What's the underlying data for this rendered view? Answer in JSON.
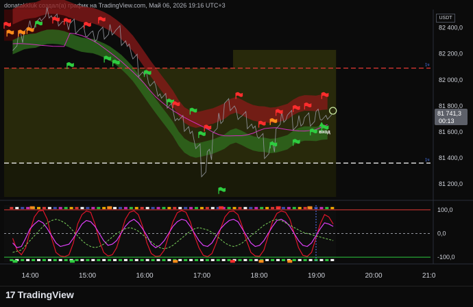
{
  "header": {
    "caption": "donatakkluk создал(а) график на TradingView.com, Май 06, 2026 19:16 UTC+3",
    "currency": "USDT"
  },
  "branding": {
    "logo_text": "TradingView",
    "logo_icon": "tradingview-logo-icon"
  },
  "colors": {
    "background": "#0b0b0b",
    "price_line": "#9598a1",
    "upper_band": "#8b1a1a",
    "lower_band": "#2e6b1e",
    "olive_zone": "#2a2b0c",
    "magenta": "#d02fbf",
    "red_level": "#e53935",
    "white_level": "#ffffff",
    "osc_red": "#e0152a",
    "osc_magenta": "#e040fb",
    "osc_green_dash": "#7cd35b",
    "buy_flag": "#2ecc40",
    "sell_flag": "#ff2d2d",
    "orange_flag": "#ff8c1a",
    "price_label_bg": "#5d6069"
  },
  "price_label": {
    "value": "81 741,3",
    "countdown": "00:13"
  },
  "annotation": {
    "text": "вход"
  },
  "level_tags": [
    "1ч",
    "1ч"
  ],
  "chart_data": [
    {
      "type": "line",
      "title": "",
      "xlabel": "",
      "ylabel": "",
      "x": [
        "14:00",
        "15:00",
        "16:00",
        "17:00",
        "18:00",
        "19:00",
        "20:00",
        "21:0"
      ],
      "y_ticks": [
        "82 400,0",
        "82 200,0",
        "82 000,0",
        "81 800,0",
        "81 600,0",
        "81 400,0",
        "81 200,0"
      ],
      "ylim": [
        81100,
        82540
      ],
      "grid": false,
      "series": [
        {
          "values": [
            [
              13.7,
              82270
            ],
            [
              13.8,
              82330
            ],
            [
              13.9,
              82390
            ],
            [
              14.0,
              82410
            ],
            [
              14.1,
              82430
            ],
            [
              14.2,
              82480
            ],
            [
              14.3,
              82520
            ],
            [
              14.4,
              82470
            ],
            [
              14.5,
              82450
            ],
            [
              14.6,
              82420
            ],
            [
              14.7,
              82440
            ],
            [
              14.8,
              82400
            ],
            [
              14.9,
              82380
            ],
            [
              15.0,
              82350
            ],
            [
              15.1,
              82330
            ],
            [
              15.2,
              82360
            ],
            [
              15.3,
              82340
            ],
            [
              15.4,
              82390
            ],
            [
              15.5,
              82380
            ],
            [
              15.6,
              82300
            ],
            [
              15.7,
              82230
            ],
            [
              15.8,
              82170
            ],
            [
              15.9,
              82070
            ],
            [
              16.0,
              82020
            ],
            [
              16.1,
              81970
            ],
            [
              16.2,
              81910
            ],
            [
              16.3,
              81850
            ],
            [
              16.4,
              81810
            ],
            [
              16.5,
              81730
            ],
            [
              16.6,
              81690
            ],
            [
              16.7,
              81640
            ],
            [
              16.8,
              81560
            ],
            [
              16.9,
              81480
            ],
            [
              17.0,
              81300
            ],
            [
              17.1,
              81430
            ],
            [
              17.2,
              81610
            ],
            [
              17.3,
              81700
            ],
            [
              17.4,
              81810
            ],
            [
              17.5,
              81790
            ],
            [
              17.6,
              81740
            ],
            [
              17.7,
              81720
            ],
            [
              17.8,
              81660
            ],
            [
              17.9,
              81600
            ],
            [
              18.0,
              81560
            ],
            [
              18.1,
              81440
            ],
            [
              18.2,
              81490
            ],
            [
              18.3,
              81640
            ],
            [
              18.4,
              81710
            ],
            [
              18.5,
              81720
            ],
            [
              18.6,
              81640
            ],
            [
              18.7,
              81690
            ],
            [
              18.8,
              81710
            ],
            [
              18.9,
              81680
            ],
            [
              19.0,
              81730
            ],
            [
              19.1,
              81700
            ],
            [
              19.2,
              81741.3
            ]
          ]
        }
      ],
      "levels": [
        {
          "value": 82090,
          "style": "dashed",
          "color": "#e53935",
          "tag": "1ч"
        },
        {
          "value": 81360,
          "style": "dashed",
          "color": "#ffffff",
          "tag": "1ч"
        }
      ],
      "current_price": 81741.3,
      "buy_flags": [
        [
          14.1,
          82450
        ],
        [
          14.65,
          82130
        ],
        [
          15.3,
          82180
        ],
        [
          15.45,
          82150
        ],
        [
          16.0,
          82070
        ],
        [
          16.4,
          81850
        ],
        [
          16.8,
          81780
        ],
        [
          16.95,
          81600
        ],
        [
          17.3,
          81170
        ],
        [
          18.2,
          81520
        ],
        [
          18.6,
          81540
        ],
        [
          18.9,
          81620
        ],
        [
          19.1,
          81650
        ]
      ],
      "sell_flags": [
        [
          13.55,
          82440
        ],
        [
          14.4,
          82480
        ],
        [
          14.6,
          82470
        ],
        [
          14.95,
          82440
        ],
        [
          15.2,
          82480
        ],
        [
          16.5,
          81830
        ],
        [
          17.05,
          81650
        ],
        [
          17.6,
          81900
        ],
        [
          18.0,
          81680
        ],
        [
          18.3,
          81770
        ],
        [
          18.6,
          81800
        ],
        [
          18.8,
          81820
        ],
        [
          19.1,
          81900
        ]
      ],
      "orange_flags": [
        [
          13.6,
          82380
        ],
        [
          13.8,
          82380
        ],
        [
          13.95,
          82400
        ],
        [
          18.2,
          81700
        ]
      ]
    },
    {
      "type": "line",
      "title": "",
      "y_ticks": [
        "100,0",
        "0,0",
        "-100,0"
      ],
      "ylim": [
        -120,
        120
      ],
      "levels": [
        {
          "value": 100,
          "color": "#e53935"
        },
        {
          "value": 0,
          "color": "#9598a1"
        },
        {
          "value": -100,
          "color": "#2ecc40"
        }
      ],
      "series": [
        {
          "values": [
            -20,
            -70,
            -90,
            -60,
            10,
            70,
            95,
            98,
            60,
            -20,
            -80,
            -95,
            -98,
            -90,
            -40,
            40,
            80,
            95,
            90,
            40,
            -30,
            -80,
            -95,
            -90,
            -60,
            0,
            60,
            90,
            96,
            80,
            30,
            -40,
            -85,
            -97,
            -95,
            -70,
            -10,
            50,
            88,
            97,
            90,
            50,
            -10,
            -60,
            -92,
            -98,
            -85,
            -40,
            20,
            70,
            92,
            95,
            80,
            30,
            -30,
            -80,
            -95,
            -96,
            -70,
            -10,
            50,
            85,
            95,
            90,
            60,
            0,
            -60,
            -92,
            -97,
            -80,
            -20,
            40,
            80,
            70,
            40
          ]
        },
        {
          "values": [
            -40,
            -60,
            -55,
            -20,
            20,
            40,
            55,
            45,
            20,
            -10,
            -40,
            -55,
            -50,
            -45,
            -20,
            10,
            40,
            55,
            50,
            30,
            0,
            -30,
            -50,
            -45,
            -30,
            0,
            30,
            50,
            60,
            45,
            20,
            -10,
            -45,
            -60,
            -50,
            -30,
            0,
            30,
            50,
            60,
            55,
            30,
            0,
            -30,
            -50,
            -55,
            -40,
            -10,
            20,
            40,
            55,
            60,
            50,
            20,
            -10,
            -40,
            -55,
            -50,
            -30,
            0,
            30,
            55,
            60,
            50,
            30,
            0,
            -30,
            -50,
            -55,
            -40,
            -10,
            20,
            45,
            40,
            30
          ]
        },
        {
          "values": [
            -80,
            -75,
            -70,
            -50,
            -30,
            -10,
            10,
            30,
            45,
            55,
            60,
            55,
            45,
            30,
            10,
            -10,
            -30,
            -45,
            -55,
            -60,
            -55,
            -45,
            -30,
            -15,
            0,
            10,
            20,
            25,
            20,
            10,
            -5,
            -20,
            -35,
            -50,
            -60,
            -65,
            -60,
            -50,
            -35,
            -20,
            -5,
            10,
            20,
            25,
            20,
            15,
            5,
            -10,
            -25,
            -40,
            -50,
            -55,
            -50,
            -40,
            -25,
            -10,
            5,
            20,
            35,
            45,
            55,
            60,
            55,
            45,
            35,
            25,
            15,
            5,
            0,
            -5,
            -10,
            -15,
            -20,
            -25,
            -30
          ]
        }
      ],
      "top_signal_flags": [
        [
          14.0,
          "orange"
        ],
        [
          15.35,
          "orange"
        ],
        [
          17.3,
          "red"
        ],
        [
          18.3,
          "red"
        ],
        [
          18.85,
          "orange"
        ]
      ],
      "bottom_signal_flags": [
        [
          13.7,
          "green"
        ],
        [
          14.7,
          "green"
        ],
        [
          16.5,
          "orange"
        ],
        [
          17.5,
          "red"
        ],
        [
          18.0,
          "orange"
        ],
        [
          18.5,
          "orange"
        ]
      ]
    }
  ]
}
